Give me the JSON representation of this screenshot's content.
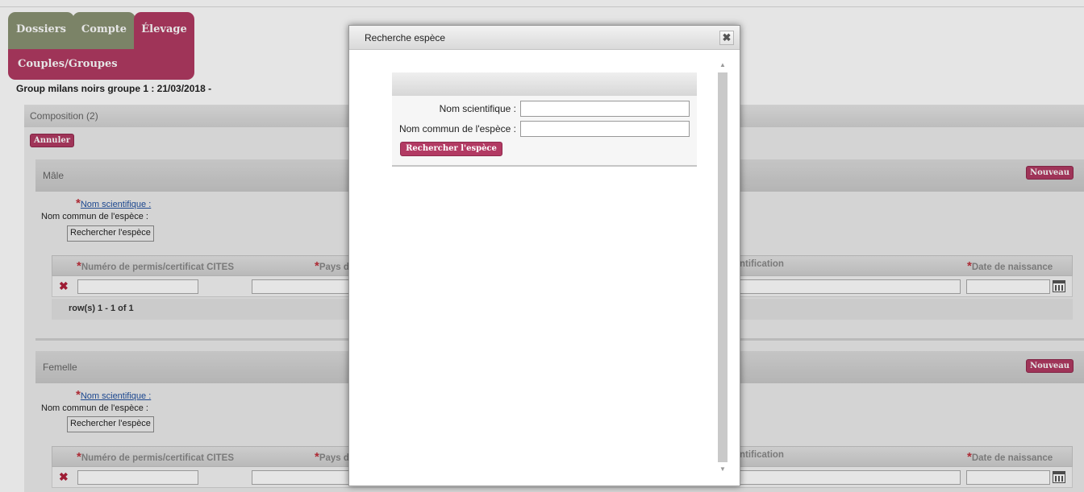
{
  "nav": {
    "tabs": [
      "Dossiers",
      "Compte",
      "Élevage"
    ],
    "subtab": "Couples/Groupes"
  },
  "group_title": "Group milans noirs groupe 1 : 21/03/2018 -",
  "composition_label": "Composition (2)",
  "cancel_label": "Annuler",
  "new_label": "Nouveau",
  "sections": [
    {
      "title": "Mâle",
      "sci_name_link": "Nom scientifique :",
      "common_name_label": "Nom commun de l'espèce :",
      "search_button": "Rechercher l'espèce",
      "columns": [
        "Numéro de permis/certificat CITES",
        "Pays d",
        "ntification",
        "Date de naissance"
      ],
      "pager": "row(s) 1 - 1 of 1"
    },
    {
      "title": "Femelle",
      "sci_name_link": "Nom scientifique :",
      "common_name_label": "Nom commun de l'espèce :",
      "search_button": "Rechercher l'espèce",
      "columns": [
        "Numéro de permis/certificat CITES",
        "Pays d",
        "ntification",
        "Date de naissance"
      ]
    }
  ],
  "modal": {
    "title": "Recherche espèce",
    "close_glyph": "✖",
    "sci_name_label": "Nom scientifique :",
    "common_name_label": "Nom commun de l'espèce :",
    "sci_name_value": "",
    "common_name_value": "",
    "search_button": "Rechercher l'espèce"
  },
  "colors": {
    "accent": "#b23a63",
    "tab_inactive": "#8a9273",
    "required_star": "#c0303b"
  }
}
